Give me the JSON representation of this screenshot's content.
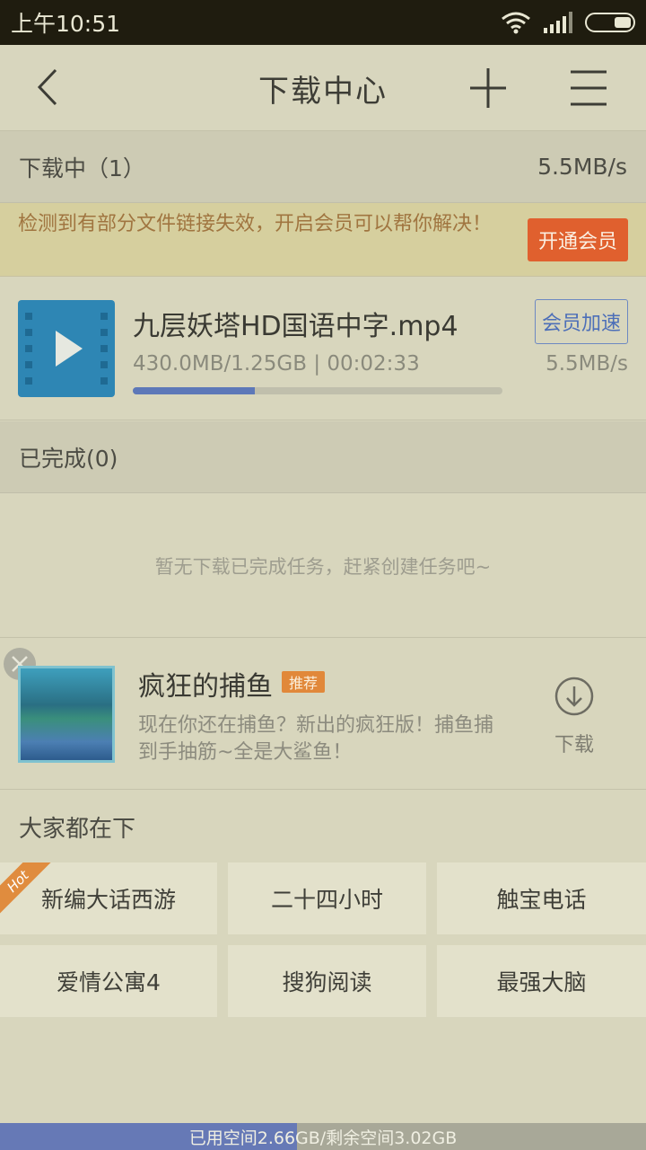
{
  "statusbar": {
    "time": "上午10:51"
  },
  "navbar": {
    "title": "下载中心"
  },
  "downloading": {
    "label": "下载中（1）",
    "speed": "5.5MB/s"
  },
  "notice": {
    "text": "检测到有部分文件链接失效，开启会员可以帮你解决！",
    "button": "开通会员"
  },
  "task": {
    "name": "九层妖塔HD国语中字.mp4",
    "meta": "430.0MB/1.25GB | 00:02:33",
    "speed": "5.5MB/s",
    "vip_button": "会员加速",
    "progress": 0.33
  },
  "completed": {
    "label": "已完成(0)",
    "empty_text": "暂无下载已完成任务，赶紧创建任务吧~"
  },
  "ad": {
    "title": "疯狂的捕鱼",
    "tag": "推荐",
    "desc": "现在你还在捕鱼？新出的疯狂版！捕鱼捕到手抽筋~全是大鲨鱼！",
    "download_label": "下载"
  },
  "popular": {
    "header": "大家都在下",
    "hot_badge": "Hot",
    "items": [
      "新编大话西游",
      "二十四小时",
      "触宝电话",
      "爱情公寓4",
      "搜狗阅读",
      "最强大脑"
    ]
  },
  "storage": {
    "label": "已用空间2.66GB/剩余空间3.02GB",
    "used_fraction": 0.46
  }
}
